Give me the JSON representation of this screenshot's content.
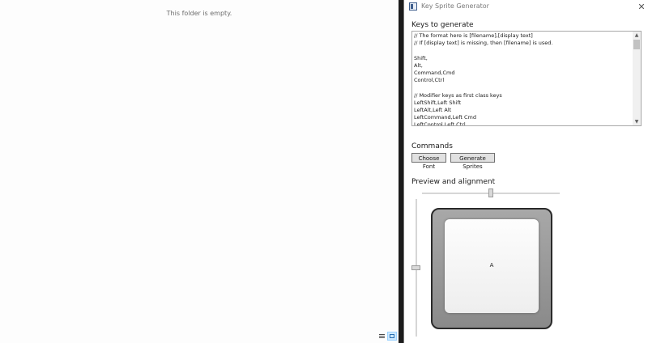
{
  "explorer": {
    "empty_message": "This folder is empty."
  },
  "window": {
    "title": "Key Sprite Generator",
    "close_glyph": "✕",
    "icon": "app-window-icon"
  },
  "keys_section": {
    "label": "Keys to generate",
    "text": "// The format here is [filename],[display text]\n// If [display text] is missing, then [filename] is used.\n\nShift,\nAlt,\nCommand,Cmd\nControl,Ctrl\n\n// Modifier keys as first class keys\nLeftShift,Left Shift\nLeftAlt,Left Alt\nLeftCommand,Left Cmd\nLeftControl,Left Ctrl"
  },
  "commands_section": {
    "label": "Commands",
    "choose_font": "Choose Font",
    "generate_sprites": "Generate Sprites"
  },
  "preview_section": {
    "label": "Preview and alignment",
    "horizontal_level": 0.5,
    "vertical_level": 0.5,
    "key_char": "A"
  },
  "icons": {
    "details_view": "details-view-icon",
    "tiles_view": "tiles-view-icon"
  },
  "colors": {
    "key_frame": "#8a8a8a",
    "key_face": "#f4f4f4",
    "selected_view": "#cce8ff"
  }
}
